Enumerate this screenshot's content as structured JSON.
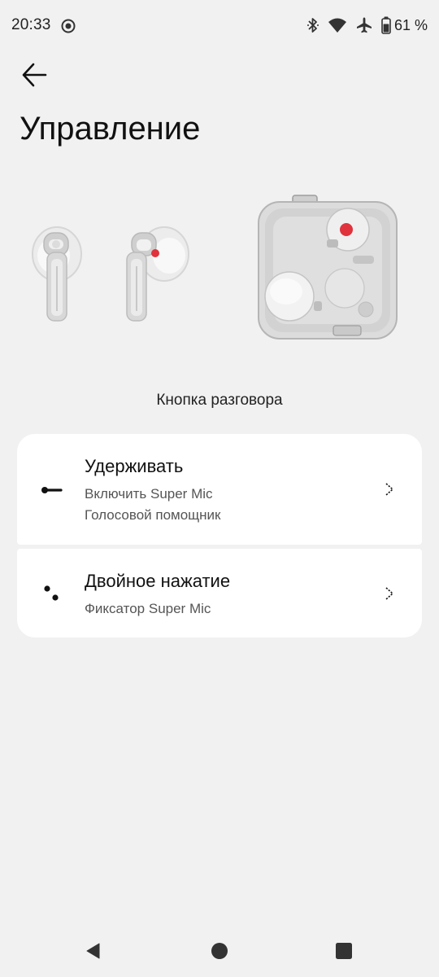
{
  "status_bar": {
    "time": "20:33",
    "battery_percent": "61 %",
    "icons": [
      "screen-record-icon",
      "bluetooth-icon",
      "wifi-icon",
      "airplane-icon",
      "battery-icon"
    ]
  },
  "header": {
    "back_icon": "arrow-left-icon",
    "title": "Управление"
  },
  "section": {
    "label": "Кнопка разговора"
  },
  "options": [
    {
      "icon": "long-press-icon",
      "title": "Удерживать",
      "subtitles": [
        "Включить Super Mic",
        "Голосовой помощник"
      ]
    },
    {
      "icon": "double-tap-icon",
      "title": "Двойное нажатие",
      "subtitles": [
        "Фиксатор Super Mic"
      ]
    }
  ],
  "nav": {
    "icons": [
      "nav-back-icon",
      "nav-home-icon",
      "nav-recents-icon"
    ]
  },
  "colors": {
    "background": "#f1f1f1",
    "card": "#ffffff",
    "accent_red": "#e0323c"
  }
}
